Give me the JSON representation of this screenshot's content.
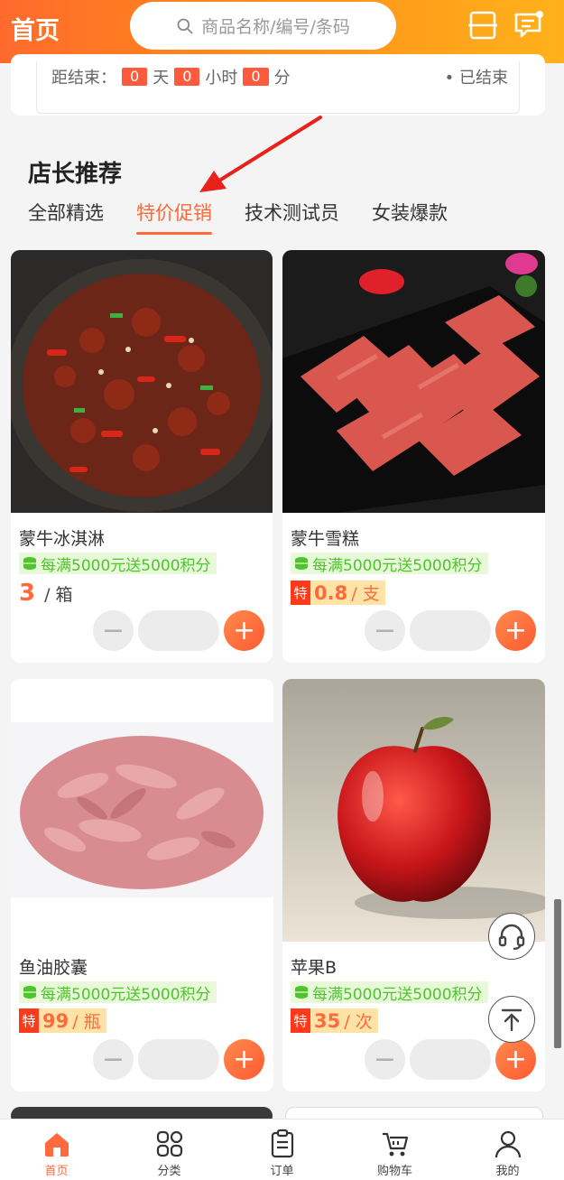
{
  "header": {
    "title": "首页",
    "search_placeholder": "商品名称/编号/条码",
    "icons": [
      "scan-icon",
      "message-icon"
    ]
  },
  "countdown": {
    "label": "距结束：",
    "days": "0",
    "days_unit": "天",
    "hours": "0",
    "hours_unit": "小时",
    "minutes": "0",
    "minutes_unit": "分",
    "status": "• 已结束"
  },
  "section": {
    "title": "店长推荐",
    "tabs": [
      {
        "label": "全部精选",
        "active": false
      },
      {
        "label": "特价促销",
        "active": true
      },
      {
        "label": "技术测试员",
        "active": false
      },
      {
        "label": "女装爆款",
        "active": false
      }
    ]
  },
  "products": [
    {
      "name": "蒙牛冰淇淋",
      "promo": "每满5000元送5000积分",
      "special": false,
      "price": "3",
      "unit": "/ 箱",
      "image": "spicy-chicken-dish"
    },
    {
      "name": "蒙牛雪糕",
      "promo": "每满5000元送5000积分",
      "special": true,
      "special_tag": "特",
      "price": "0.8",
      "unit": "/ 支",
      "image": "sliced-beef-platter"
    },
    {
      "name": "鱼油胶囊",
      "promo": "每满5000元送5000积分",
      "special": true,
      "special_tag": "特",
      "price": "99",
      "unit": "/ 瓶",
      "image": "shredded-pork"
    },
    {
      "name": "苹果B",
      "promo": "每满5000元送5000积分",
      "special": true,
      "special_tag": "特",
      "price": "35",
      "unit": "/ 次",
      "image": "red-apple"
    }
  ],
  "bottom_nav": [
    {
      "label": "首页",
      "icon": "home-icon",
      "active": true
    },
    {
      "label": "分类",
      "icon": "category-icon",
      "active": false
    },
    {
      "label": "订单",
      "icon": "order-icon",
      "active": false
    },
    {
      "label": "购物车",
      "icon": "cart-icon",
      "active": false
    },
    {
      "label": "我的",
      "icon": "user-icon",
      "active": false
    }
  ],
  "colors": {
    "accent": "#ff6a3d",
    "header_start": "#ff6a2c",
    "header_end": "#ffb21a",
    "promo_green": "#4fc42c",
    "special_red": "#ff3a1c"
  }
}
